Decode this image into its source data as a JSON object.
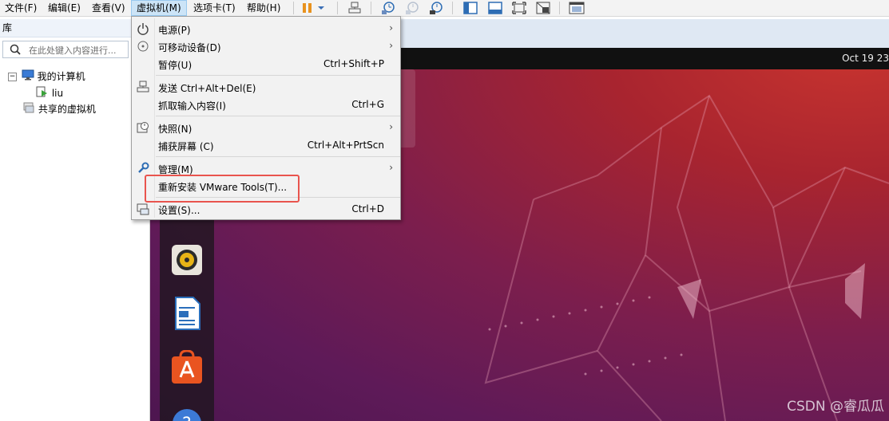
{
  "menubar": {
    "items": [
      {
        "label": "文件(F)"
      },
      {
        "label": "编辑(E)"
      },
      {
        "label": "查看(V)"
      },
      {
        "label": "虚拟机(M)"
      },
      {
        "label": "选项卡(T)"
      },
      {
        "label": "帮助(H)"
      }
    ]
  },
  "library": {
    "title": "库",
    "search_placeholder": "在此处键入内容进行...",
    "tree": [
      {
        "label": "我的计算机"
      },
      {
        "label": "liu"
      },
      {
        "label": "共享的虚拟机"
      }
    ]
  },
  "guest": {
    "clock": "Oct 19  23"
  },
  "vm_menu": {
    "items": [
      {
        "label": "电源(P)",
        "shortcut": "",
        "submenu": true,
        "icon": "power-icon"
      },
      {
        "label": "可移动设备(D)",
        "shortcut": "",
        "submenu": true,
        "icon": "removable-device-icon"
      },
      {
        "label": "暂停(U)",
        "shortcut": "Ctrl+Shift+P",
        "submenu": false,
        "icon": ""
      },
      {
        "label": "发送 Ctrl+Alt+Del(E)",
        "shortcut": "",
        "submenu": false,
        "icon": "send-keys-icon"
      },
      {
        "label": "抓取输入内容(I)",
        "shortcut": "Ctrl+G",
        "submenu": false,
        "icon": ""
      },
      {
        "label": "快照(N)",
        "shortcut": "",
        "submenu": true,
        "icon": "snapshot-icon"
      },
      {
        "label": "捕获屏幕 (C)",
        "shortcut": "Ctrl+Alt+PrtScn",
        "submenu": false,
        "icon": ""
      },
      {
        "label": "管理(M)",
        "shortcut": "",
        "submenu": true,
        "icon": "wrench-icon"
      },
      {
        "label": "重新安装 VMware Tools(T)...",
        "shortcut": "",
        "submenu": false,
        "icon": ""
      },
      {
        "label": "设置(S)...",
        "shortcut": "Ctrl+D",
        "submenu": false,
        "icon": "settings-icon"
      }
    ]
  },
  "watermark": "CSDN @睿瓜瓜",
  "colors": {
    "highlight_box": "#e9544e",
    "menu_active": "#cce4f7",
    "ubuntu_dark": "#4d1650",
    "ubuntu_orange": "#e95420"
  }
}
